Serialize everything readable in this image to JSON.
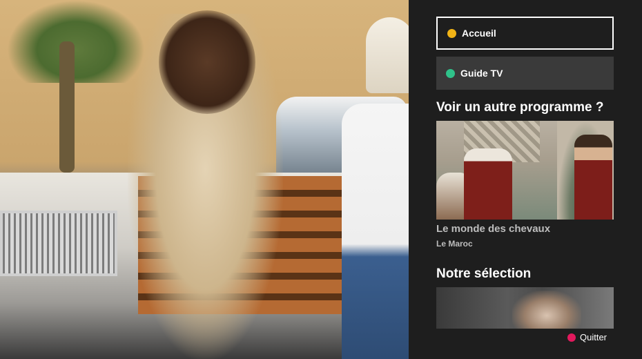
{
  "menu": {
    "items": [
      {
        "label": "Accueil",
        "color": "#f2b416",
        "active": true
      },
      {
        "label": "Guide TV",
        "color": "#2fc28a",
        "active": false
      }
    ]
  },
  "other_program": {
    "heading": "Voir un autre programme ?",
    "title": "Le monde des chevaux",
    "subtitle": "Le Maroc"
  },
  "selection": {
    "heading": "Notre sélection"
  },
  "quit": {
    "label": "Quitter",
    "color": "#e3195d"
  },
  "colors": {
    "panel_bg": "#1e1e1e",
    "button_bg": "#3a3a3a",
    "text": "#ffffff",
    "muted_text": "#bdbdbd"
  }
}
